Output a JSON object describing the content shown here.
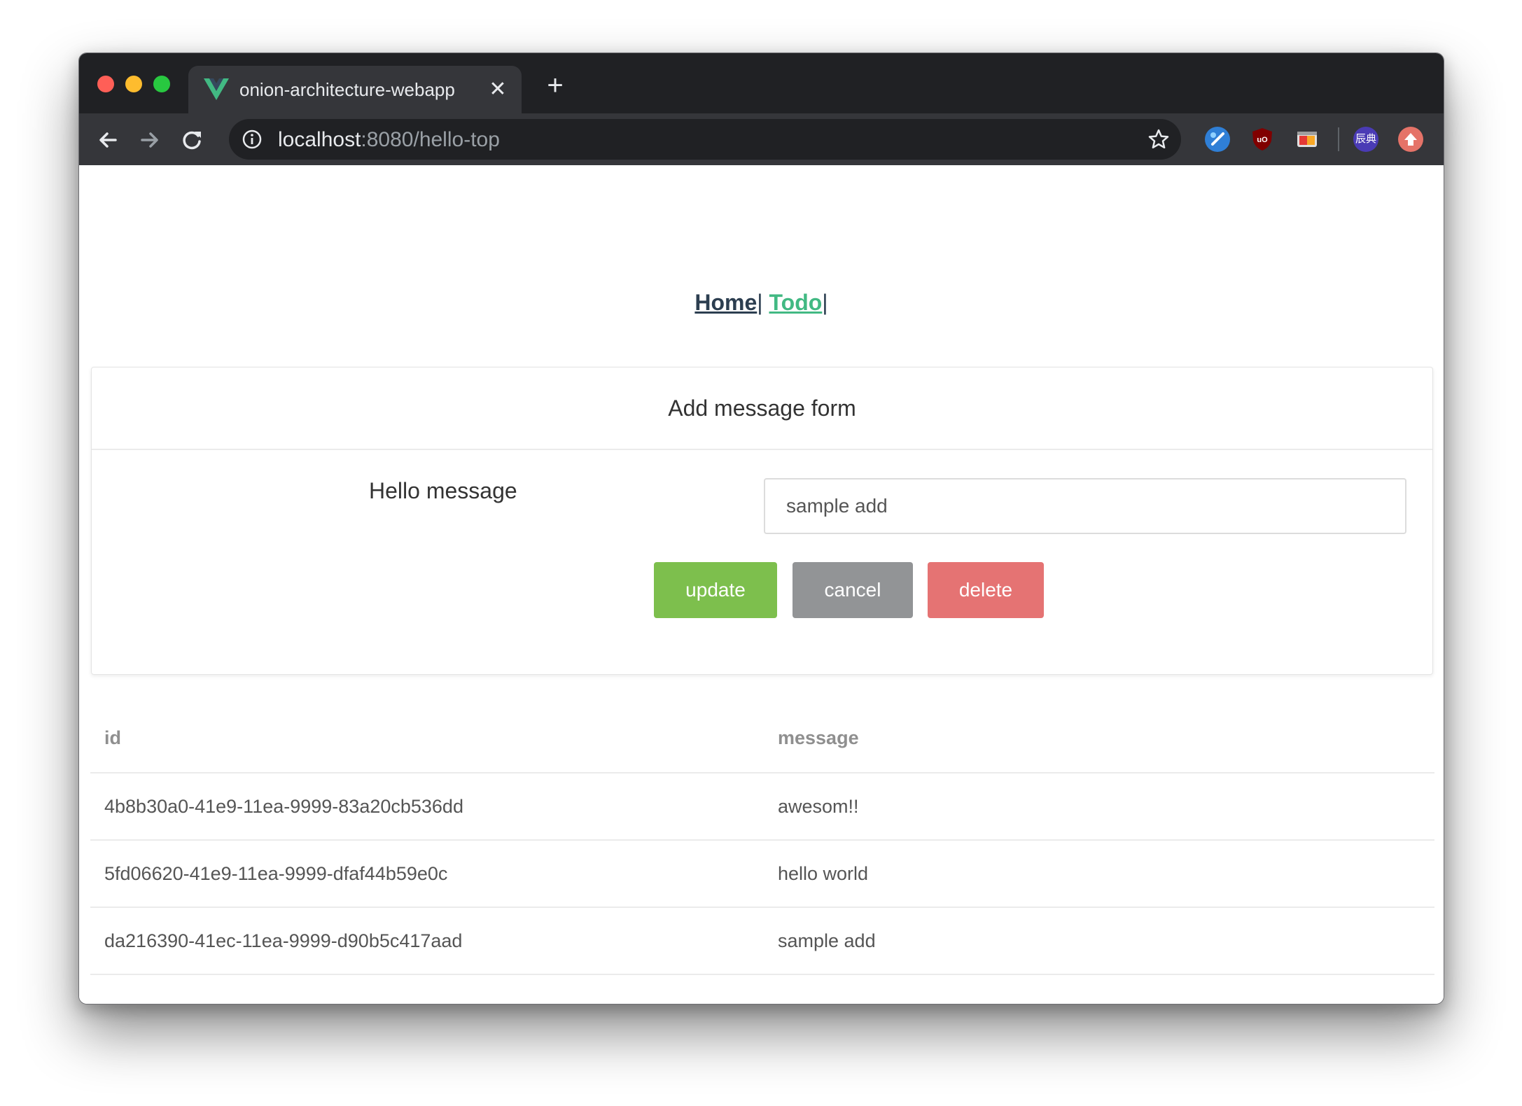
{
  "browser": {
    "tab_title": "onion-architecture-webapp",
    "tab_close_glyph": "✕",
    "new_tab_glyph": "+",
    "url_host": "localhost",
    "url_rest": ":8080/hello-top",
    "extensions": [
      "vue-devtools-icon",
      "ublock-origin-icon",
      "screenshot-extension-icon",
      "dictionary-extension-icon",
      "upload-extension-icon"
    ],
    "extension_dict_label": "辰典"
  },
  "nav": {
    "home_label": "Home",
    "todo_label": "Todo",
    "separator": "|"
  },
  "form": {
    "title": "Add message form",
    "field_label": "Hello message",
    "field_value": "sample add",
    "update_label": "update",
    "cancel_label": "cancel",
    "delete_label": "delete"
  },
  "table": {
    "columns": [
      "id",
      "message"
    ],
    "rows": [
      {
        "id": "4b8b30a0-41e9-11ea-9999-83a20cb536dd",
        "message": "awesom!!"
      },
      {
        "id": "5fd06620-41e9-11ea-9999-dfaf44b59e0c",
        "message": "hello world"
      },
      {
        "id": "da216390-41ec-11ea-9999-d90b5c417aad",
        "message": "sample add"
      }
    ]
  },
  "colors": {
    "update": "#7dbf4d",
    "cancel": "#929496",
    "delete": "#e57373",
    "vue_green": "#42b983",
    "vue_dark": "#2c3e50"
  }
}
